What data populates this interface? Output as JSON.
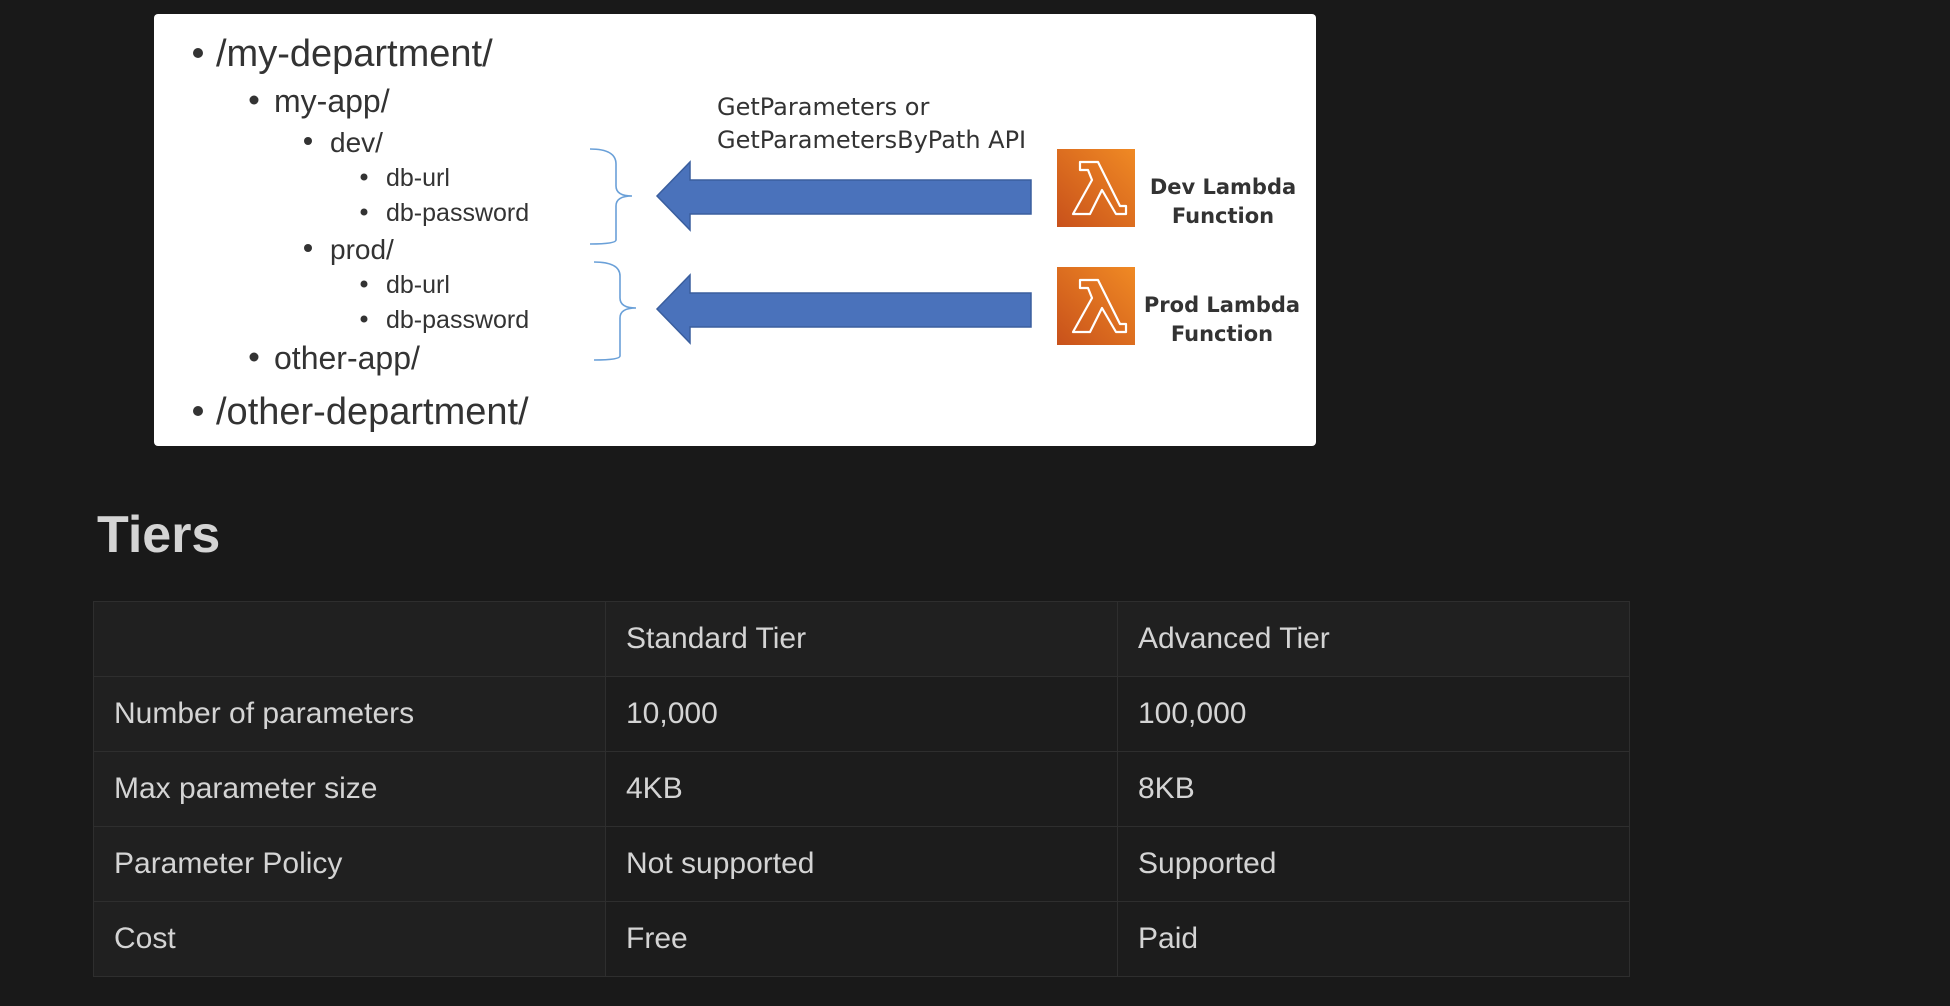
{
  "diagram": {
    "tree": {
      "root1": "/my-department/",
      "app1": "my-app/",
      "env_dev": "dev/",
      "dev_db_url": "db-url",
      "dev_db_password": "db-password",
      "env_prod": "prod/",
      "prod_db_url": "db-url",
      "prod_db_password": "db-password",
      "app2": "other-app/",
      "root2": "/other-department/"
    },
    "api_label_line1": "GetParameters or",
    "api_label_line2": "GetParametersByPath API",
    "dev_function_line1": "Dev Lambda",
    "dev_function_line2": "Function",
    "prod_function_line1": "Prod Lambda",
    "prod_function_line2": "Function",
    "lambda_icon": "lambda-icon",
    "colors": {
      "arrow": "#4a72bb",
      "lambda_orange": "#e0711f",
      "bracket": "#5b9bd5"
    }
  },
  "heading": "Tiers",
  "table": {
    "headers": [
      "",
      "Standard Tier",
      "Advanced Tier"
    ],
    "rows": [
      [
        "Number of parameters",
        "10,000",
        "100,000"
      ],
      [
        "Max parameter size",
        "4KB",
        "8KB"
      ],
      [
        "Parameter Policy",
        "Not supported",
        "Supported"
      ],
      [
        "Cost",
        "Free",
        "Paid"
      ]
    ]
  }
}
